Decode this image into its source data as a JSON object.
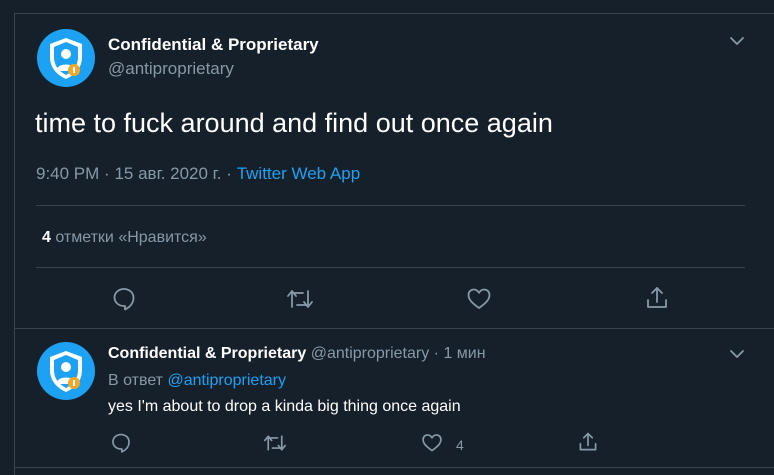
{
  "tweet": {
    "author_name": "Confidential & Proprietary",
    "author_handle": "@antiproprietary",
    "text": "time to fuck around and find out once again",
    "time": "9:40 PM",
    "separator1": "·",
    "date": "15 авг. 2020 г.",
    "separator2": "·",
    "source": "Twitter Web App",
    "like_count": "4",
    "like_label": "отметки «Нравится»",
    "actions": [
      "reply-icon",
      "retweet-icon",
      "like-icon",
      "share-icon"
    ]
  },
  "reply": {
    "author_name": "Confidential & Proprietary",
    "author_handle": "@antiproprietary",
    "dot": "·",
    "time": "1 мин",
    "in_reply_prefix": "В ответ",
    "in_reply_mention": "@antiproprietary",
    "text": "yes I'm about to drop a kinda big thing once again",
    "like_count": "4",
    "actions": [
      "reply-icon",
      "retweet-icon",
      "like-icon",
      "share-icon"
    ]
  },
  "colors": {
    "background": "#15202b",
    "border": "#38444d",
    "secondary_text": "#8899a6",
    "accent": "#1da1f2",
    "avatar_badge": "#f5a623"
  }
}
